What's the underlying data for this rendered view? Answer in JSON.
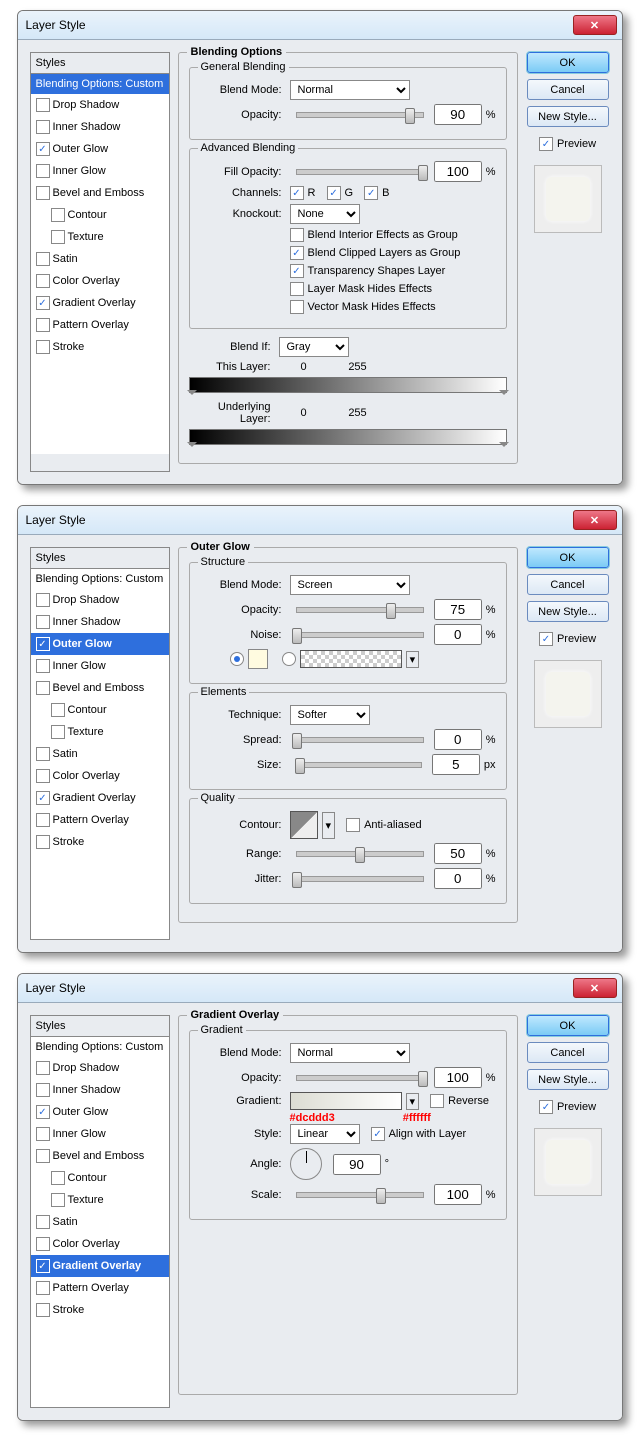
{
  "title": "Layer Style",
  "stylesHdr": "Styles",
  "items": [
    "Blending Options: Custom",
    "Drop Shadow",
    "Inner Shadow",
    "Outer Glow",
    "Inner Glow",
    "Bevel and Emboss",
    "Contour",
    "Texture",
    "Satin",
    "Color Overlay",
    "Gradient Overlay",
    "Pattern Overlay",
    "Stroke"
  ],
  "rb": {
    "ok": "OK",
    "cancel": "Cancel",
    "ns": "New Style...",
    "pv": "Preview"
  },
  "d1": {
    "hdr": "Blending Options",
    "gb": "General Blending",
    "ab": "Advanced Blending",
    "bm": "Blend Mode:",
    "bmv": "Normal",
    "op": "Opacity:",
    "opv": "90",
    "pct": "%",
    "fo": "Fill Opacity:",
    "fov": "100",
    "ch": "Channels:",
    "r": "R",
    "g": "G",
    "b": "B",
    "ko": "Knockout:",
    "kov": "None",
    "c1": "Blend Interior Effects as Group",
    "c2": "Blend Clipped Layers as Group",
    "c3": "Transparency Shapes Layer",
    "c4": "Layer Mask Hides Effects",
    "c5": "Vector Mask Hides Effects",
    "bi": "Blend If:",
    "biv": "Gray",
    "tl": "This Layer:",
    "tlv": "0",
    "tlv2": "255",
    "ul": "Underlying Layer:",
    "ulv": "0",
    "ulv2": "255"
  },
  "d2": {
    "hdr": "Outer Glow",
    "st": "Structure",
    "bm": "Blend Mode:",
    "bmv": "Screen",
    "op": "Opacity:",
    "opv": "75",
    "noise": "Noise:",
    "nv": "0",
    "el": "Elements",
    "tech": "Technique:",
    "techv": "Softer",
    "sp": "Spread:",
    "spv": "0",
    "sz": "Size:",
    "szv": "5",
    "px": "px",
    "q": "Quality",
    "ct": "Contour:",
    "aa": "Anti-aliased",
    "rg": "Range:",
    "rgv": "50",
    "jt": "Jitter:",
    "jtv": "0",
    "pct": "%"
  },
  "d3": {
    "hdr": "Gradient Overlay",
    "gr": "Gradient",
    "bm": "Blend Mode:",
    "bmv": "Normal",
    "op": "Opacity:",
    "opv": "100",
    "grl": "Gradient:",
    "rev": "Reverse",
    "c1": "#dcddd3",
    "c2": "#ffffff",
    "stl": "Style:",
    "stlv": "Linear",
    "al": "Align with Layer",
    "an": "Angle:",
    "anv": "90",
    "deg": "°",
    "sc": "Scale:",
    "scv": "100",
    "pct": "%"
  }
}
